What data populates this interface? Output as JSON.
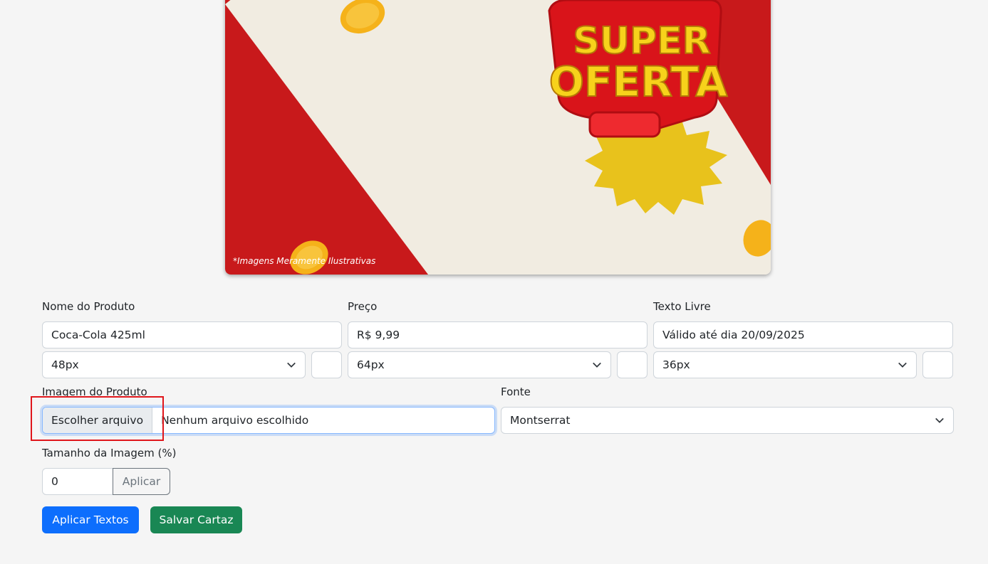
{
  "poster": {
    "title_line1": "SUPER",
    "title_line2": "OFERTA",
    "disclaimer": "*Imagens Meramente Ilustrativas",
    "colors": {
      "red": "#c8191b",
      "cream": "#f1ece1",
      "yellow": "#e8c21c",
      "gold": "#f5b21a"
    }
  },
  "form": {
    "product_name": {
      "label": "Nome do Produto",
      "value": "Coca-Cola 425ml",
      "size": "48px"
    },
    "price": {
      "label": "Preço",
      "value": "R$ 9,99",
      "size": "64px"
    },
    "free_text": {
      "label": "Texto Livre",
      "value": "Válido até dia 20/09/2025",
      "size": "36px"
    },
    "image": {
      "label": "Imagem do Produto",
      "button": "Escolher arquivo",
      "status": "Nenhum arquivo escolhido"
    },
    "font": {
      "label": "Fonte",
      "value": "Montserrat"
    },
    "image_size": {
      "label": "Tamanho da Imagem (%)",
      "value": "0",
      "apply": "Aplicar"
    }
  },
  "actions": {
    "apply_texts": "Aplicar Textos",
    "save_poster": "Salvar Cartaz"
  }
}
